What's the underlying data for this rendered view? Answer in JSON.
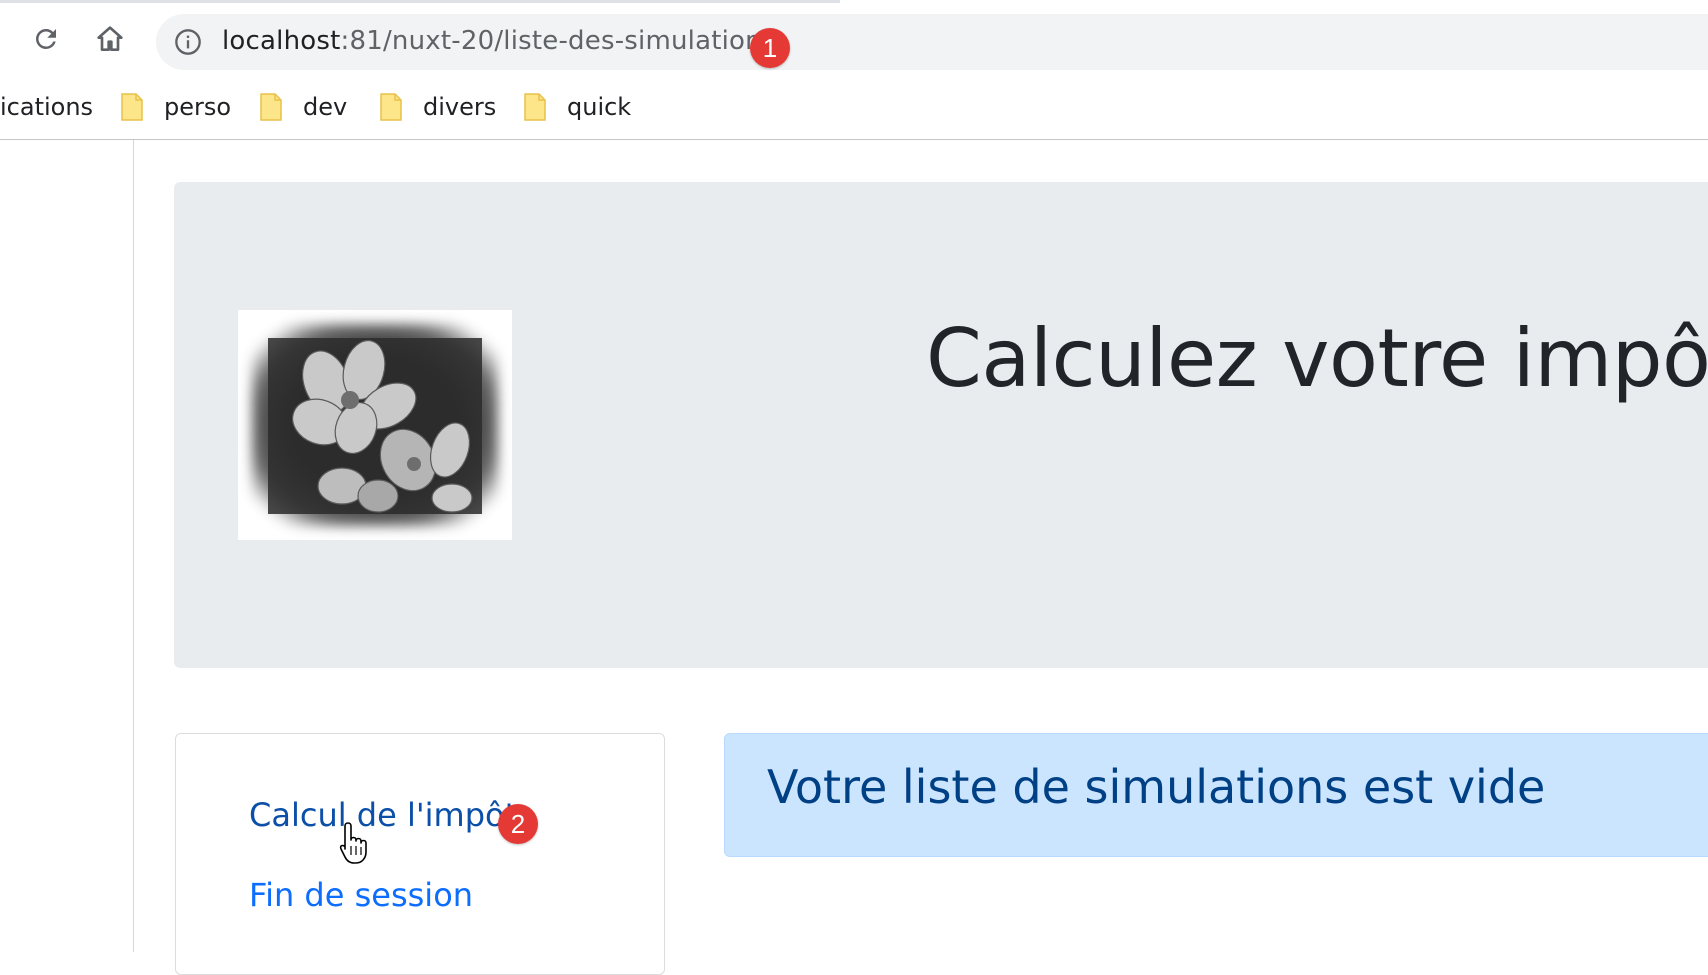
{
  "browser": {
    "url_host": "localhost",
    "url_path": ":81/nuxt-20/liste-des-simulations",
    "reload_icon": "reload-icon",
    "home_icon": "home-icon",
    "site_info_icon": "info-circle-icon",
    "bookmarks": [
      {
        "label": "ications",
        "icon": "apps-partial"
      },
      {
        "label": "perso",
        "icon": "folder-icon"
      },
      {
        "label": "dev",
        "icon": "folder-icon"
      },
      {
        "label": "divers",
        "icon": "folder-icon"
      },
      {
        "label": "quick",
        "icon": "folder-icon"
      }
    ]
  },
  "annotations": {
    "badge_1": "1",
    "badge_2": "2",
    "badge_color": "#e53935"
  },
  "page": {
    "title": "Calculez votre impôt",
    "logo_icon": "flower-photo",
    "menu": {
      "items": [
        {
          "label": "Calcul de l'impôt"
        },
        {
          "label": "Fin de session"
        }
      ]
    },
    "alert": {
      "message": "Votre liste de simulations est vide",
      "background": "#cce5ff",
      "text_color": "#004085"
    }
  },
  "colors": {
    "jumbotron_bg": "#e9ecef",
    "link": "#0d6efd"
  }
}
